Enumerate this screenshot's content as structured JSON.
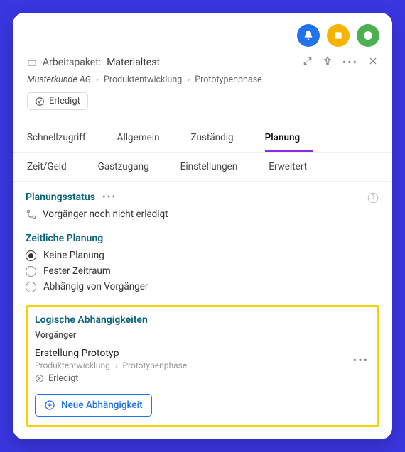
{
  "topbar": {
    "notif_icon": "bell",
    "note_icon": "note",
    "time_icon": "clock"
  },
  "header": {
    "card_icon": "card",
    "prefix": "Arbeitspaket:",
    "name": "Materialtest",
    "breadcrumb": {
      "org": "Musterkunde AG",
      "path1": "Produktentwicklung",
      "path2": "Prototypenphase"
    },
    "status_label": "Erledigt"
  },
  "tabs": {
    "row1": [
      "Schnellzugriff",
      "Allgemein",
      "Zuständig",
      "Planung"
    ],
    "row2": [
      "Zeit/Geld",
      "Gastzugang",
      "Einstellungen",
      "Erweitert"
    ],
    "active": "Planung"
  },
  "planungsstatus": {
    "heading": "Planungsstatus",
    "text": "Vorgänger noch nicht erledigt"
  },
  "zeitliche_planung": {
    "heading": "Zeitliche Planung",
    "options": [
      "Keine Planung",
      "Fester Zeitraum",
      "Abhängig von Vorgänger"
    ],
    "selected": 0
  },
  "logische": {
    "heading": "Logische Abhängigkeiten",
    "subtitle": "Vorgänger",
    "item": {
      "title": "Erstellung Prototyp",
      "path1": "Produktentwicklung",
      "path2": "Prototypenphase",
      "status": "Erledigt"
    },
    "add_label": "Neue Abhängigkeit"
  }
}
